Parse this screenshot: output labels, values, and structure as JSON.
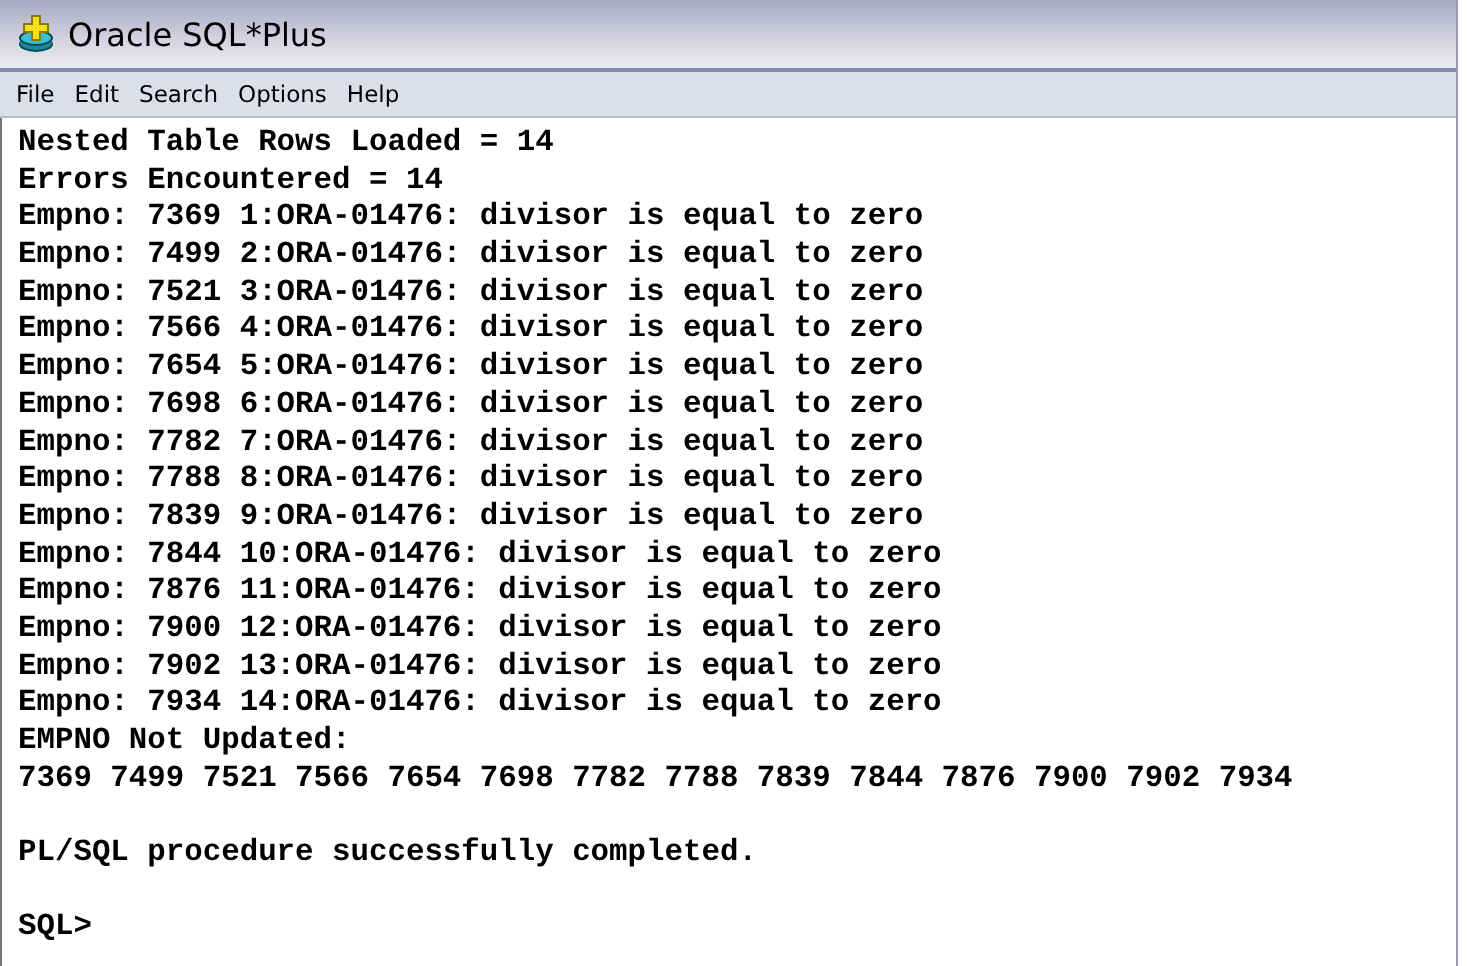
{
  "window": {
    "title": "Oracle SQL*Plus"
  },
  "menu": [
    "File",
    "Edit",
    "Search",
    "Options",
    "Help"
  ],
  "output_blocks": [
    [
      "Nested Table Rows Loaded = 14",
      "Errors Encountered = 14",
      "Empno: 7369 1:ORA-01476: divisor is equal to zero",
      "Empno: 7499 2:ORA-01476: divisor is equal to zero",
      "Empno: 7521 3:ORA-01476: divisor is equal to zero",
      "Empno: 7566 4:ORA-01476: divisor is equal to zero",
      "Empno: 7654 5:ORA-01476: divisor is equal to zero",
      "Empno: 7698 6:ORA-01476: divisor is equal to zero",
      "Empno: 7782 7:ORA-01476: divisor is equal to zero",
      "Empno: 7788 8:ORA-01476: divisor is equal to zero",
      "Empno: 7839 9:ORA-01476: divisor is equal to zero",
      "Empno: 7844 10:ORA-01476: divisor is equal to zero",
      "Empno: 7876 11:ORA-01476: divisor is equal to zero",
      "Empno: 7900 12:ORA-01476: divisor is equal to zero",
      "Empno: 7902 13:ORA-01476: divisor is equal to zero",
      "Empno: 7934 14:ORA-01476: divisor is equal to zero",
      "EMPNO Not Updated:",
      "7369 7499 7521 7566 7654 7698 7782 7788 7839 7844 7876 7900 7902 7934"
    ],
    [
      "PL/SQL procedure successfully completed."
    ],
    [
      "SQL>"
    ]
  ]
}
